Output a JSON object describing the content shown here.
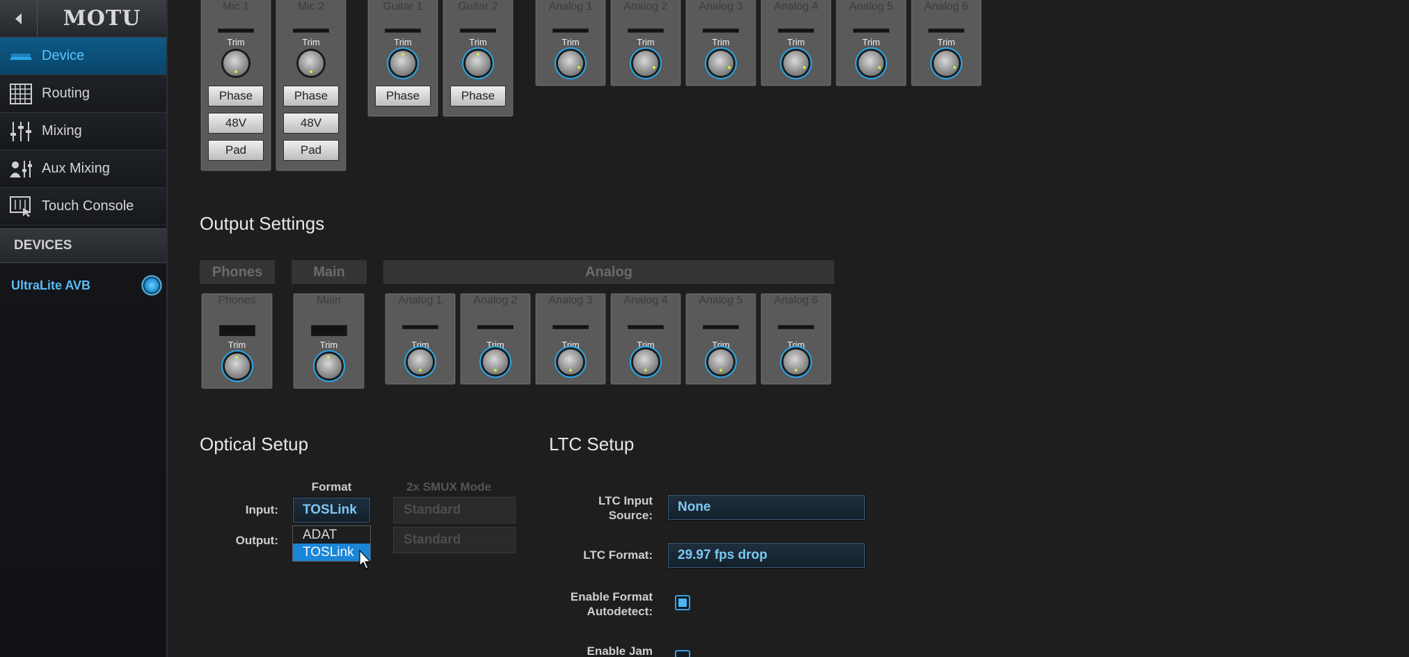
{
  "sidebar": {
    "logo": "MOTU",
    "nav": [
      {
        "label": "Device",
        "icon": "device-icon",
        "active": true
      },
      {
        "label": "Routing",
        "icon": "routing-grid-icon",
        "active": false
      },
      {
        "label": "Mixing",
        "icon": "mixer-faders-icon",
        "active": false
      },
      {
        "label": "Aux Mixing",
        "icon": "aux-mixing-icon",
        "active": false
      },
      {
        "label": "Touch Console",
        "icon": "touch-console-icon",
        "active": false
      }
    ],
    "devices_header": "DEVICES",
    "device_name": "UltraLite AVB"
  },
  "inputs": {
    "strips": [
      {
        "name": "Mic 1",
        "trim": "Trim",
        "phase": "Phase",
        "v48": "48V",
        "pad": "Pad"
      },
      {
        "name": "Mic 2",
        "trim": "Trim",
        "phase": "Phase",
        "v48": "48V",
        "pad": "Pad"
      },
      {
        "name": "Guitar 1",
        "trim": "Trim",
        "phase": "Phase"
      },
      {
        "name": "Guitar 2",
        "trim": "Trim",
        "phase": "Phase"
      },
      {
        "name": "Analog 1",
        "trim": "Trim"
      },
      {
        "name": "Analog 2",
        "trim": "Trim"
      },
      {
        "name": "Analog 3",
        "trim": "Trim"
      },
      {
        "name": "Analog 4",
        "trim": "Trim"
      },
      {
        "name": "Analog 5",
        "trim": "Trim"
      },
      {
        "name": "Analog 6",
        "trim": "Trim"
      }
    ]
  },
  "output_settings": {
    "title": "Output Settings",
    "groups": {
      "phones": "Phones",
      "main": "Main",
      "analog": "Analog"
    },
    "strips": [
      {
        "name": "Phones",
        "trim": "Trim"
      },
      {
        "name": "Main",
        "trim": "Trim"
      },
      {
        "name": "Analog 1",
        "trim": "Trim"
      },
      {
        "name": "Analog 2",
        "trim": "Trim"
      },
      {
        "name": "Analog 3",
        "trim": "Trim"
      },
      {
        "name": "Analog 4",
        "trim": "Trim"
      },
      {
        "name": "Analog 5",
        "trim": "Trim"
      },
      {
        "name": "Analog 6",
        "trim": "Trim"
      }
    ]
  },
  "optical_setup": {
    "title": "Optical Setup",
    "format_header": "Format",
    "smux_header": "2x SMUX Mode",
    "input_label": "Input:",
    "output_label": "Output:",
    "input_format": "TOSLink",
    "input_smux": "Standard",
    "output_smux": "Standard",
    "dropdown_options": [
      "ADAT",
      "TOSLink"
    ],
    "dropdown_selected": "TOSLink"
  },
  "ltc_setup": {
    "title": "LTC Setup",
    "input_source_label_1": "LTC Input",
    "input_source_label_2": "Source:",
    "input_source_value": "None",
    "format_label": "LTC Format:",
    "format_value": "29.97 fps drop",
    "autodetect_label_1": "Enable Format",
    "autodetect_label_2": "Autodetect:",
    "autodetect_checked": true,
    "jam_label": "Enable Jam",
    "jam_checked": false
  },
  "colors": {
    "accent": "#2aa7e8",
    "active_nav": "#0e5a86",
    "knob_tick": "#c8f03a"
  }
}
